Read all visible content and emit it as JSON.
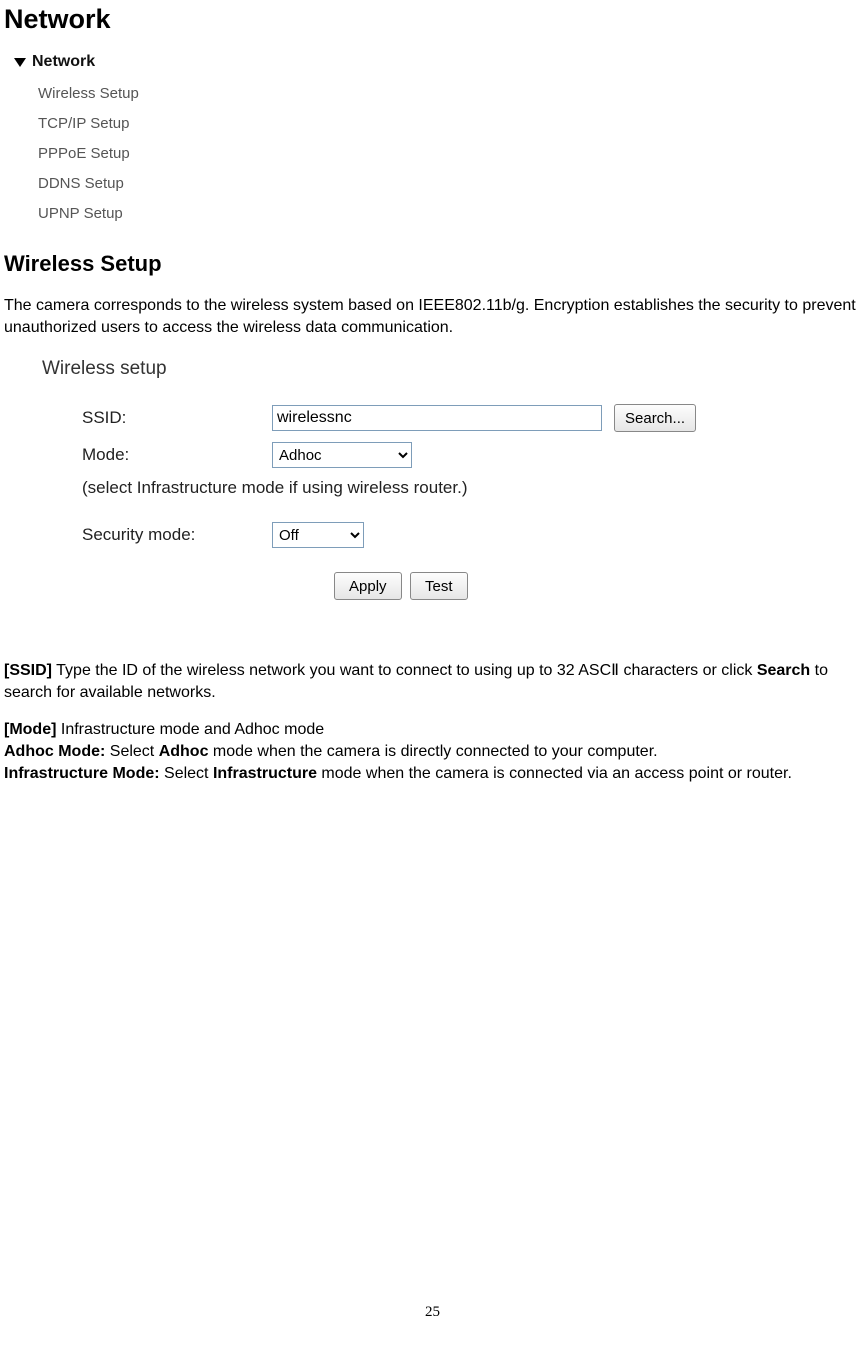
{
  "page": {
    "title": "Network",
    "number": "25"
  },
  "nav": {
    "header": "Network",
    "items": [
      "Wireless Setup",
      "TCP/IP Setup",
      "PPPoE Setup",
      "DDNS Setup",
      "UPNP Setup"
    ]
  },
  "section": {
    "title": "Wireless Setup",
    "intro": "The camera corresponds to the wireless system based on IEEE802.11b/g. Encryption establishes the security to prevent unauthorized users to access the wireless data communication."
  },
  "panel": {
    "title": "Wireless setup",
    "ssid_label": "SSID:",
    "ssid_value": "wirelessnc",
    "search_label": "Search...",
    "mode_label": "Mode:",
    "mode_value": "Adhoc",
    "mode_note": "(select Infrastructure mode if using wireless router.)",
    "security_label": "Security mode:",
    "security_value": "Off",
    "apply_label": "Apply",
    "test_label": "Test"
  },
  "desc": {
    "ssid_bold": "[SSID]",
    "ssid_text_a": " Type the ID of the wireless network you want to connect to using up to 32 ASCⅡ characters or click ",
    "ssid_bold2": "Search",
    "ssid_text_b": " to search for available networks.",
    "mode_bold": "[Mode]",
    "mode_text": " Infrastructure mode and Adhoc mode",
    "adhoc_bold": "Adhoc Mode:",
    "adhoc_text_a": " Select ",
    "adhoc_bold2": "Adhoc",
    "adhoc_text_b": " mode when the camera is directly connected to your computer.",
    "infra_bold": "Infrastructure Mode:",
    "infra_text_a": " Select ",
    "infra_bold2": "Infrastructure",
    "infra_text_b": " mode when the camera is connected via an access point or router."
  }
}
